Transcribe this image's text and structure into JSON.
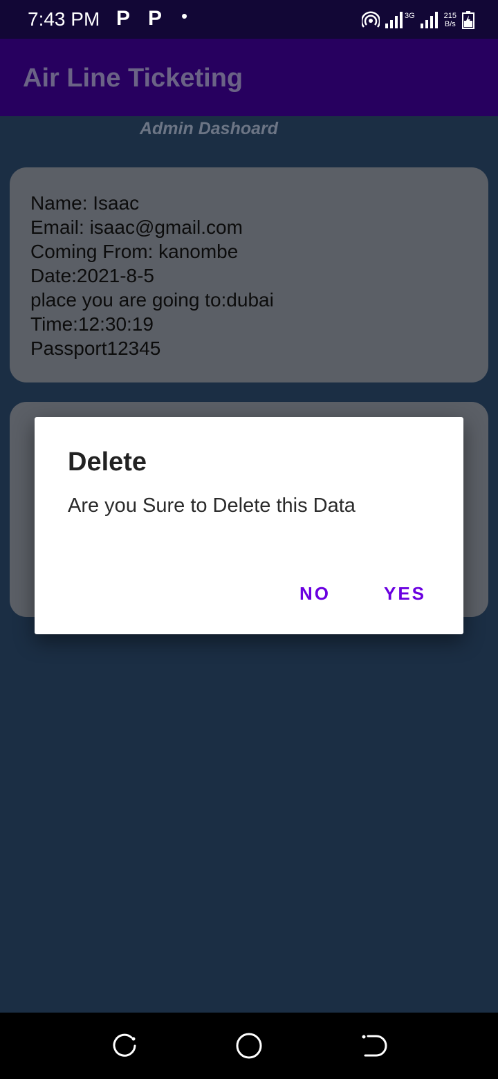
{
  "status_bar": {
    "time": "7:43 PM",
    "notification_icons": [
      "P",
      "P",
      "•"
    ],
    "network_type": "3G",
    "net_speed_value": "215",
    "net_speed_unit": "B/s",
    "icons": [
      "hotspot-icon",
      "signal-icon",
      "signal-icon",
      "battery-charging-icon"
    ]
  },
  "app_bar": {
    "title": "Air Line Ticketing"
  },
  "page": {
    "subtitle": "Admin Dashoard"
  },
  "cards": [
    {
      "lines": [
        "Name: Isaac",
        "Email: isaac@gmail.com",
        "Coming From: kanombe",
        "Date:2021-8-5",
        "place you are going to:dubai",
        "Time:12:30:19",
        "Passport12345"
      ]
    }
  ],
  "dialog": {
    "title": "Delete",
    "message": "Are you Sure to Delete this Data",
    "negative_button": "NO",
    "positive_button": "YES"
  },
  "nav_bar": {
    "icons": [
      "recent-apps-icon",
      "home-icon",
      "back-icon"
    ]
  },
  "colors": {
    "background": "#1b2e44",
    "status_bar": "#120736",
    "app_bar": "#27005f",
    "card": "#5b5f66",
    "dialog_button": "#6a00e0"
  }
}
